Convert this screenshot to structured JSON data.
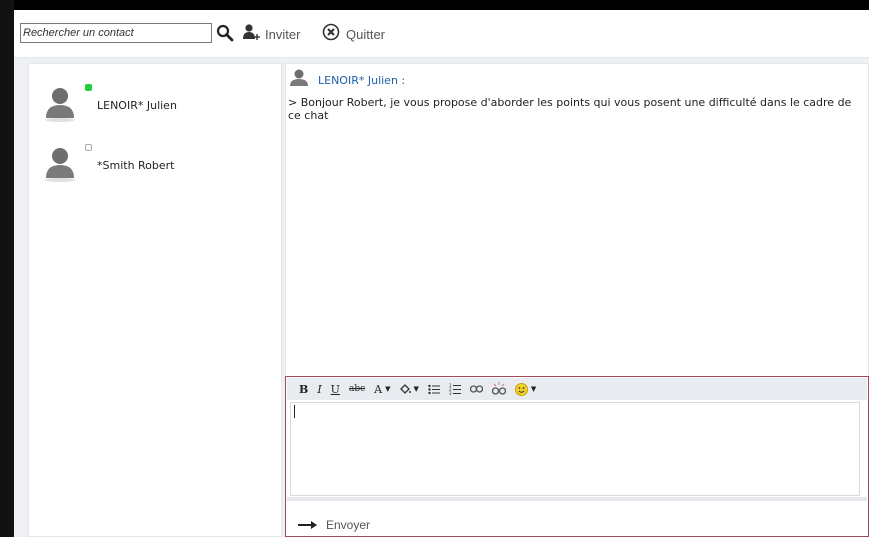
{
  "toolbar": {
    "search": {
      "value": "Rechercher un contact"
    },
    "invite_label": "Inviter",
    "quit_label": "Quitter"
  },
  "contacts": [
    {
      "name": "LENOIR* Julien",
      "status": "online",
      "status_color": "#1fcf3a"
    },
    {
      "name": "*Smith Robert",
      "status": "offline",
      "status_color": "#d4d4d4"
    }
  ],
  "chat": {
    "messages": [
      {
        "author": "LENOIR* Julien :",
        "text": "> Bonjour Robert, je vous propose d'aborder les points qui vous posent une difficulté dans le cadre de ce chat"
      }
    ]
  },
  "editor": {
    "tools": [
      "B",
      "I",
      "U",
      "abc",
      "A"
    ],
    "send_label": "Envoyer"
  },
  "colors": {
    "accent_link": "#1f5fa8",
    "editor_border": "#a04a5a"
  }
}
